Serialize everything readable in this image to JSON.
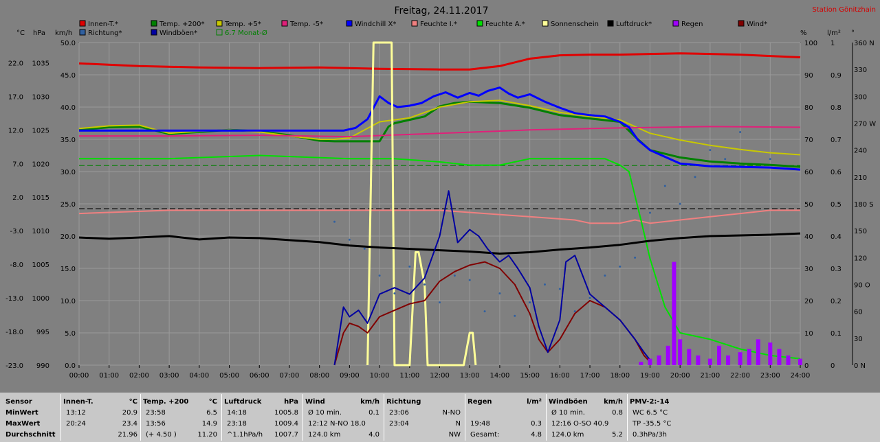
{
  "title": "Freitag, 24.11.2017",
  "station": "Station Gönitzhain",
  "axis_units": {
    "temp": "°C",
    "pressure": "hPa",
    "wind": "km/h",
    "percent": "%",
    "rain": "l/m²",
    "direction": "°"
  },
  "legend": [
    {
      "label": "Innen-T.*",
      "color": "#e00000"
    },
    {
      "label": "Temp. +200*",
      "color": "#008000"
    },
    {
      "label": "Temp. +5*",
      "color": "#c8c800"
    },
    {
      "label": "Temp. -5*",
      "color": "#e0207a"
    },
    {
      "label": "Windchill X*",
      "color": "#0000ff"
    },
    {
      "label": "Feuchte I.*",
      "color": "#f08080"
    },
    {
      "label": "Feuchte A.*",
      "color": "#00e000"
    },
    {
      "label": "Sonnenschein",
      "color": "#ffff99"
    },
    {
      "label": "Luftdruck*",
      "color": "#000000"
    },
    {
      "label": "Regen",
      "color": "#a000ff"
    },
    {
      "label": "Wind*",
      "color": "#800000"
    },
    {
      "label": "Richtung*",
      "color": "#3060a0"
    },
    {
      "label": "Windböen*",
      "color": "#0000a0"
    },
    {
      "label": "6.7 Monat-Ø",
      "color": "#008000"
    }
  ],
  "chart_data": {
    "type": "line",
    "title": "Freitag, 24.11.2017",
    "x_ticks": [
      "00:00",
      "01:00",
      "02:00",
      "03:00",
      "04:00",
      "05:00",
      "06:00",
      "07:00",
      "08:00",
      "09:00",
      "10:00",
      "11:00",
      "12:00",
      "13:00",
      "14:00",
      "15:00",
      "16:00",
      "17:00",
      "18:00",
      "19:00",
      "20:00",
      "21:00",
      "22:00",
      "23:00",
      "24:00"
    ],
    "axes": {
      "temp_c": {
        "ticks": [
          "22.0",
          "17.0",
          "12.0",
          "7.0",
          "2.0",
          "-3.0",
          "-8.0",
          "-13.0",
          "-18.0",
          "-23.0"
        ],
        "range": [
          -23,
          25
        ]
      },
      "pressure_hpa": {
        "ticks": [
          "1035",
          "1030",
          "1025",
          "1020",
          "1015",
          "1010",
          "1005",
          "1000",
          "995",
          "990"
        ],
        "range": [
          990,
          1038
        ]
      },
      "wind_kmh": {
        "ticks": [
          "50.0",
          "45.0",
          "40.0",
          "35.0",
          "30.0",
          "25.0",
          "20.0",
          "15.0",
          "10.0",
          "5.0",
          "0.0"
        ],
        "range": [
          0,
          50
        ]
      },
      "percent": {
        "ticks": [
          "100",
          "90",
          "80",
          "70",
          "60",
          "50",
          "40",
          "30",
          "20",
          "10",
          "0"
        ],
        "range": [
          0,
          100
        ]
      },
      "rain_lm2": {
        "ticks": [
          "1",
          "0.9",
          "0.8",
          "0.7",
          "0.6",
          "0.5",
          "0.4",
          "0.3",
          "0.2",
          "0.1",
          "0"
        ],
        "range": [
          0,
          1
        ]
      },
      "direction_deg": {
        "ticks": [
          "360 N",
          "330",
          "300",
          "270 W",
          "240",
          "210",
          "180 S",
          "150",
          "120",
          "90 O",
          "60",
          "30",
          "0 N"
        ],
        "range": [
          0,
          360
        ]
      }
    },
    "series": [
      {
        "name": "Innen-T.*",
        "axis": "temp_c",
        "x": [
          0,
          2,
          4,
          6,
          8,
          10,
          12,
          13,
          14,
          15,
          16,
          17,
          18,
          19,
          20,
          21,
          22,
          23,
          24
        ],
        "y": [
          21.9,
          21.5,
          21.3,
          21.2,
          21.3,
          21.1,
          21.0,
          21.0,
          21.5,
          22.6,
          23.1,
          23.2,
          23.2,
          23.3,
          23.4,
          23.3,
          23.2,
          23.0,
          22.8
        ]
      },
      {
        "name": "Temp. +200*",
        "axis": "temp_c",
        "x": [
          0,
          1,
          2,
          3,
          4,
          5,
          6,
          7,
          8,
          8.5,
          9,
          10,
          10.3,
          10.5,
          11,
          11.5,
          12,
          12.5,
          13,
          14,
          15,
          16,
          17,
          18,
          18.5,
          19,
          20,
          21,
          22,
          23,
          24
        ],
        "y": [
          12.0,
          12.4,
          12.5,
          11.4,
          11.7,
          12.0,
          11.8,
          11.2,
          10.4,
          10.3,
          10.3,
          10.3,
          12.5,
          13.0,
          13.5,
          14.0,
          15.5,
          16.0,
          16.2,
          16.0,
          15.3,
          14.2,
          13.7,
          13.2,
          11.0,
          9.0,
          7.9,
          7.3,
          7.0,
          6.8,
          6.5
        ]
      },
      {
        "name": "Temp. +5*",
        "axis": "temp_c",
        "x": [
          0,
          1,
          2,
          3,
          4,
          5,
          6,
          7,
          8,
          8.5,
          9,
          10,
          11,
          12,
          13,
          14,
          15,
          16,
          17,
          18,
          18.5,
          19,
          20,
          21,
          22,
          23,
          24
        ],
        "y": [
          12.2,
          12.6,
          12.7,
          11.5,
          11.8,
          12.0,
          11.7,
          11.1,
          10.6,
          10.6,
          10.8,
          13.2,
          13.8,
          15.4,
          16.2,
          16.4,
          15.6,
          14.6,
          14.0,
          13.5,
          12.5,
          11.5,
          10.5,
          9.7,
          9.1,
          8.6,
          8.3
        ]
      },
      {
        "name": "Temp. -5*",
        "axis": "temp_c",
        "x": [
          0,
          3,
          6,
          9,
          12,
          15,
          18,
          21,
          24
        ],
        "y": [
          11.1,
          11.1,
          11.2,
          11.0,
          11.5,
          12.0,
          12.3,
          12.5,
          12.4
        ]
      },
      {
        "name": "Windchill X*",
        "axis": "temp_c",
        "x": [
          0,
          2,
          4,
          6,
          8,
          8.8,
          9.2,
          9.6,
          10,
          10.3,
          10.6,
          11,
          11.4,
          11.8,
          12.2,
          12.6,
          13,
          13.3,
          13.6,
          14,
          14.3,
          14.6,
          15,
          15.5,
          16,
          16.5,
          17,
          17.5,
          18,
          18.3,
          18.6,
          19,
          19.5,
          20,
          21,
          22,
          23,
          24
        ],
        "y": [
          11.9,
          11.9,
          11.9,
          11.9,
          11.9,
          11.9,
          12.3,
          13.6,
          17.0,
          16.0,
          15.4,
          15.6,
          16.0,
          17.0,
          17.6,
          16.8,
          17.5,
          17.1,
          17.8,
          18.3,
          17.4,
          16.8,
          17.3,
          16.2,
          15.3,
          14.5,
          14.2,
          14.0,
          13.2,
          12.4,
          10.5,
          9.0,
          8.0,
          7.0,
          6.6,
          6.5,
          6.4,
          6.1
        ]
      },
      {
        "name": "Feuchte I.*",
        "axis": "percent",
        "x": [
          0,
          3,
          6,
          9,
          12,
          15,
          16.5,
          17,
          18,
          18.5,
          19,
          20,
          21,
          22,
          23,
          24
        ],
        "y": [
          47,
          48,
          48,
          48,
          48,
          46,
          45,
          44,
          44,
          45,
          44,
          45,
          46,
          47,
          48,
          48
        ]
      },
      {
        "name": "Feuchte A.*",
        "axis": "percent",
        "x": [
          0,
          3,
          6,
          9,
          10.5,
          12,
          13,
          14,
          15,
          16,
          17,
          17.5,
          18,
          18.3,
          18.7,
          19,
          19.5,
          20,
          21,
          22,
          23,
          24
        ],
        "y": [
          64,
          64,
          65,
          64,
          64,
          63,
          62,
          62,
          64,
          64,
          64,
          64,
          62,
          60,
          45,
          33,
          18,
          10,
          8,
          5,
          3,
          2
        ]
      },
      {
        "name": "Sonnenschein",
        "axis": "percent",
        "x": [
          9.6,
          9.8,
          9.9,
          10.2,
          10.4,
          10.5,
          11.0,
          11.2,
          11.3,
          11.5,
          11.6,
          12.8,
          13.0,
          13.1,
          13.2
        ],
        "y": [
          0,
          100,
          100,
          100,
          100,
          0,
          0,
          35,
          35,
          25,
          0,
          0,
          10,
          10,
          0
        ]
      },
      {
        "name": "Luftdruck*",
        "axis": "pressure_hpa",
        "x": [
          0,
          1,
          2,
          3,
          4,
          5,
          6,
          7,
          8,
          9,
          10,
          11,
          12,
          13,
          14,
          15,
          16,
          17,
          18,
          19,
          20,
          21,
          22,
          23,
          24
        ],
        "y": [
          1009.0,
          1008.8,
          1009.0,
          1009.2,
          1008.7,
          1009.0,
          1008.9,
          1008.6,
          1008.3,
          1007.8,
          1007.5,
          1007.3,
          1007.1,
          1006.9,
          1006.6,
          1006.8,
          1007.2,
          1007.5,
          1007.9,
          1008.5,
          1008.9,
          1009.2,
          1009.3,
          1009.4,
          1009.6
        ]
      },
      {
        "name": "Wind*",
        "axis": "wind_kmh",
        "x": [
          8.5,
          8.8,
          9.0,
          9.3,
          9.6,
          10.0,
          10.5,
          11.0,
          11.5,
          12.0,
          12.5,
          13.0,
          13.5,
          14.0,
          14.5,
          15.0,
          15.3,
          15.6,
          16.0,
          16.5,
          17.0,
          17.5,
          18.0,
          18.5,
          18.8,
          19.0
        ],
        "y": [
          0,
          5,
          6.5,
          6.0,
          5.0,
          7.5,
          8.5,
          9.5,
          10.0,
          13.0,
          14.5,
          15.5,
          16.0,
          15.0,
          12.5,
          8.0,
          4.0,
          2.0,
          4.0,
          8.0,
          10.0,
          9.0,
          7.0,
          4.0,
          1.5,
          0.5
        ]
      },
      {
        "name": "Windböen*",
        "axis": "wind_kmh",
        "x": [
          8.5,
          8.8,
          9.0,
          9.3,
          9.6,
          10.0,
          10.5,
          11.0,
          11.5,
          12.0,
          12.3,
          12.6,
          13.0,
          13.3,
          13.6,
          14.0,
          14.3,
          14.6,
          15.0,
          15.3,
          15.6,
          16.0,
          16.2,
          16.5,
          17.0,
          17.5,
          18.0,
          18.5,
          18.8,
          19.0
        ],
        "y": [
          0,
          9,
          7.5,
          8.5,
          6.5,
          11,
          12,
          11,
          13.5,
          20,
          27,
          19,
          21,
          20,
          18,
          16,
          17,
          15,
          12,
          6,
          2,
          7,
          16,
          17,
          11,
          9,
          7,
          4,
          2,
          0.8
        ]
      },
      {
        "name": "Regen",
        "axis": "rain_lm2",
        "x": [
          18.7,
          19.0,
          19.3,
          19.6,
          19.8,
          20.0,
          20.3,
          20.6,
          21.0,
          21.3,
          21.6,
          22.0,
          22.3,
          22.6,
          23.0,
          23.3,
          23.6,
          24.0
        ],
        "y": [
          0.01,
          0.02,
          0.03,
          0.06,
          0.32,
          0.08,
          0.05,
          0.03,
          0.02,
          0.06,
          0.03,
          0.04,
          0.05,
          0.08,
          0.07,
          0.05,
          0.03,
          0.02
        ]
      },
      {
        "name": "Richtung*",
        "axis": "direction_deg",
        "x": [
          8.5,
          9.0,
          9.5,
          10.0,
          10.5,
          11.0,
          11.5,
          12.0,
          12.5,
          13.0,
          13.5,
          14.0,
          14.5,
          15.0,
          15.5,
          16.0,
          16.5,
          17.0,
          17.5,
          18.0,
          18.5,
          19.0,
          19.5,
          20.0,
          20.5,
          21.0,
          21.5,
          22.0,
          23.0
        ],
        "y": [
          160,
          140,
          130,
          100,
          80,
          110,
          90,
          70,
          100,
          95,
          60,
          80,
          55,
          70,
          90,
          85,
          60,
          75,
          100,
          110,
          120,
          170,
          200,
          180,
          210,
          240,
          230,
          260,
          230
        ]
      }
    ],
    "reference_lines": [
      {
        "label": "6.7 Monat-Ø",
        "axis": "temp_c",
        "value": 6.7,
        "color": "#008000",
        "dash": true
      },
      {
        "axis": "percent",
        "value": 48.5,
        "color": "#000000",
        "dash": true
      }
    ],
    "grid": true
  },
  "stats": {
    "row_labels": [
      "Sensor",
      "MinWert",
      "MaxWert",
      "Durchschnitt"
    ],
    "columns": [
      {
        "head": "Innen-T.",
        "unit": "°C",
        "rows": [
          [
            "13:12",
            "20.9"
          ],
          [
            "20:24",
            "23.4"
          ],
          [
            "",
            "21.96"
          ]
        ]
      },
      {
        "head": "Temp. +200",
        "unit": "°C",
        "rows": [
          [
            "23:58",
            "6.5"
          ],
          [
            "13:56",
            "14.9"
          ],
          [
            "(+ 4.50 )",
            "11.20"
          ]
        ]
      },
      {
        "head": "Luftdruck",
        "unit": "hPa",
        "rows": [
          [
            "14:18",
            "1005.8"
          ],
          [
            "23:18",
            "1009.4"
          ],
          [
            "^1.1hPa/h",
            "1007.7"
          ]
        ]
      },
      {
        "head": "Wind",
        "unit": "km/h",
        "rows": [
          [
            "Ø 10 min.",
            "0.1"
          ],
          [
            "12:12    N-NO 18.0",
            ""
          ],
          [
            "124.0 km",
            "4.0"
          ]
        ]
      },
      {
        "head": "Richtung",
        "unit": "",
        "rows": [
          [
            "23:06",
            "N-NO"
          ],
          [
            "23:04",
            "N"
          ],
          [
            "",
            "NW"
          ]
        ]
      },
      {
        "head": "Regen",
        "unit": "l/m²",
        "rows": [
          [
            "",
            ""
          ],
          [
            "19:48",
            "0.3"
          ],
          [
            "Gesamt:",
            "4.8"
          ]
        ]
      },
      {
        "head": "Windböen",
        "unit": "km/h",
        "rows": [
          [
            "Ø 10 min.",
            "0.8"
          ],
          [
            "12:16    O-SO 40.9",
            ""
          ],
          [
            "124.0 km",
            "5.2"
          ]
        ]
      },
      {
        "head": "PMV-2:-14",
        "unit": "",
        "rows": [
          [
            "WC 6.5 °C",
            ""
          ],
          [
            "TP -35.5 °C",
            ""
          ],
          [
            "0.3hPa/3h",
            ""
          ]
        ]
      }
    ]
  }
}
